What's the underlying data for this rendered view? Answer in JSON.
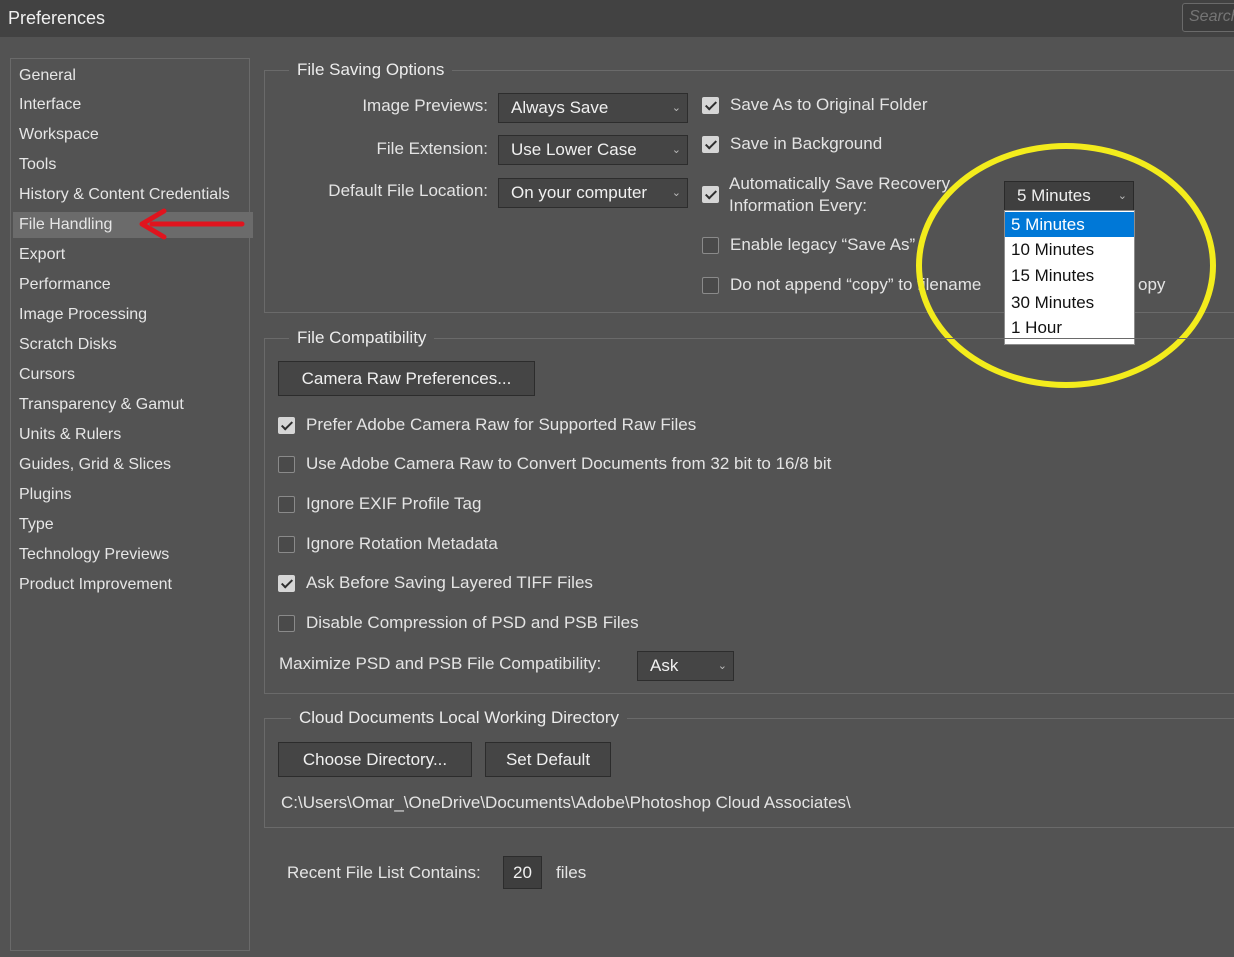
{
  "window": {
    "title": "Preferences"
  },
  "search": {
    "placeholder": "Search"
  },
  "sidebar": {
    "items": [
      {
        "label": "General"
      },
      {
        "label": "Interface"
      },
      {
        "label": "Workspace"
      },
      {
        "label": "Tools"
      },
      {
        "label": "History & Content Credentials"
      },
      {
        "label": "File Handling",
        "selected": true
      },
      {
        "label": "Export"
      },
      {
        "label": "Performance"
      },
      {
        "label": "Image Processing"
      },
      {
        "label": "Scratch Disks"
      },
      {
        "label": "Cursors"
      },
      {
        "label": "Transparency & Gamut"
      },
      {
        "label": "Units & Rulers"
      },
      {
        "label": "Guides, Grid & Slices"
      },
      {
        "label": "Plugins"
      },
      {
        "label": "Type"
      },
      {
        "label": "Technology Previews"
      },
      {
        "label": "Product Improvement"
      }
    ]
  },
  "file_saving": {
    "title": "File Saving Options",
    "image_previews_label": "Image Previews:",
    "image_previews_value": "Always Save",
    "file_extension_label": "File Extension:",
    "file_extension_value": "Use Lower Case",
    "default_location_label": "Default File Location:",
    "default_location_value": "On your computer",
    "save_as_original": {
      "label": "Save As to Original Folder",
      "checked": true
    },
    "save_background": {
      "label": "Save in Background",
      "checked": true
    },
    "auto_save": {
      "label_line1": "Automatically Save Recovery",
      "label_line2": "Information Every:",
      "checked": true
    },
    "auto_save_interval": "5 Minutes",
    "interval_options": [
      "5 Minutes",
      "10 Minutes",
      "15 Minutes",
      "30 Minutes",
      "1 Hour"
    ],
    "legacy_save_as": {
      "label": "Enable legacy “Save As”",
      "checked": false
    },
    "no_copy": {
      "label": "Do not append “copy” to filename",
      "suffix": "opy",
      "checked": false
    }
  },
  "file_compat": {
    "title": "File Compatibility",
    "camera_raw_button": "Camera Raw Preferences...",
    "options": [
      {
        "label": "Prefer Adobe Camera Raw for Supported Raw Files",
        "checked": true
      },
      {
        "label": "Use Adobe Camera Raw to Convert Documents from 32 bit to 16/8 bit",
        "checked": false
      },
      {
        "label": "Ignore EXIF Profile Tag",
        "checked": false
      },
      {
        "label": "Ignore Rotation Metadata",
        "checked": false
      },
      {
        "label": "Ask Before Saving Layered TIFF Files",
        "checked": true
      },
      {
        "label": "Disable Compression of PSD and PSB Files",
        "checked": false
      }
    ],
    "maximize_label": "Maximize PSD and PSB File Compatibility:",
    "maximize_value": "Ask"
  },
  "cloud_docs": {
    "title": "Cloud Documents Local Working Directory",
    "choose_button": "Choose Directory...",
    "default_button": "Set Default",
    "path": "C:\\Users\\Omar_\\OneDrive\\Documents\\Adobe\\Photoshop Cloud Associates\\"
  },
  "recent": {
    "label": "Recent File List Contains:",
    "value": "20",
    "unit": "files"
  },
  "colors": {
    "annotation_circle": "#f3ec1c",
    "annotation_arrow": "#e0141e",
    "menu_highlight": "#0078d7"
  }
}
